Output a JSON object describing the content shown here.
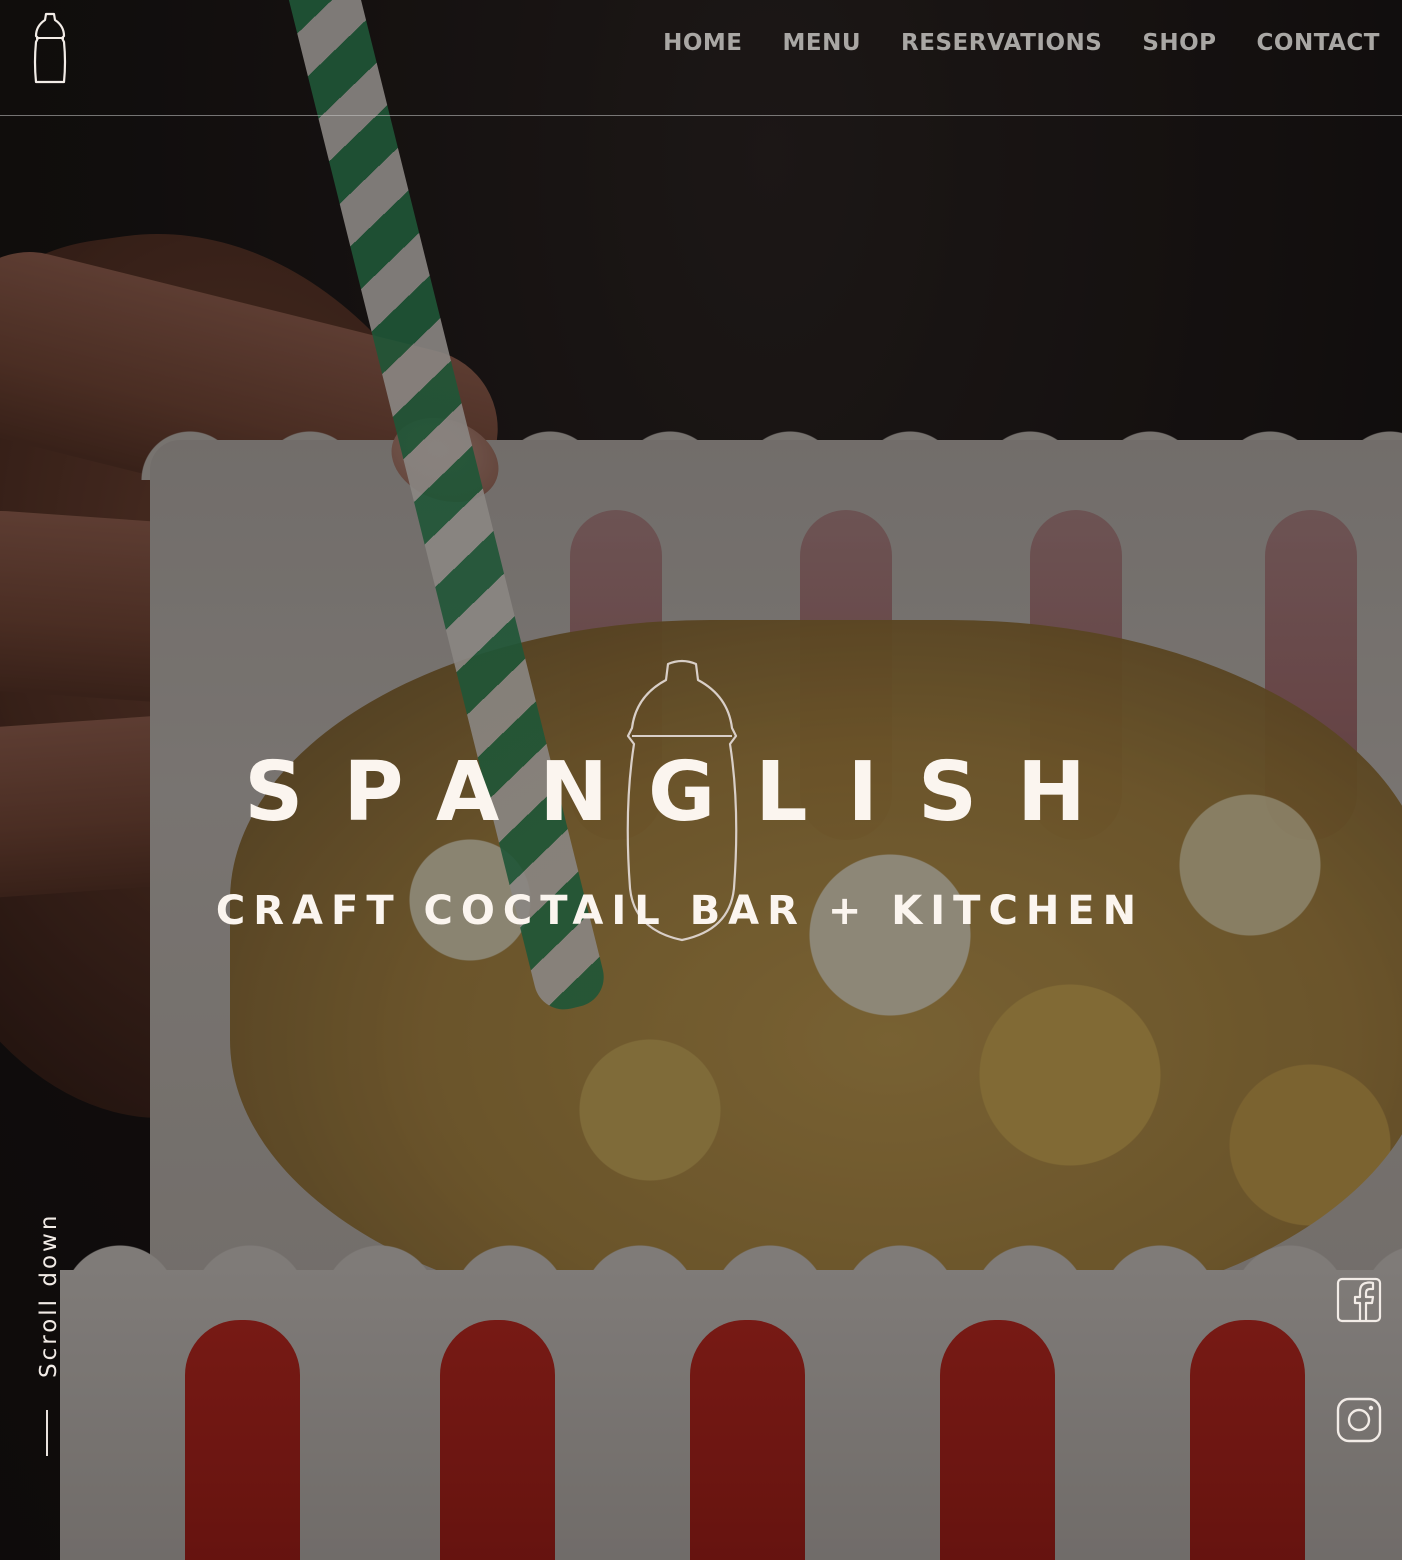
{
  "nav": {
    "items": [
      "Home",
      "Menu",
      "Reservations",
      "Shop",
      "Contact"
    ]
  },
  "hero": {
    "title": "SPANGLISH",
    "subtitle": "Craft Coctail Bar + Kitchen"
  },
  "scroll": {
    "label": "Scroll down"
  },
  "social": {
    "icons": [
      "facebook-icon",
      "instagram-icon"
    ]
  },
  "colors": {
    "nav_text": "#a9a7a4",
    "hero_text": "#fbf5ef",
    "background": "#1a1614"
  }
}
